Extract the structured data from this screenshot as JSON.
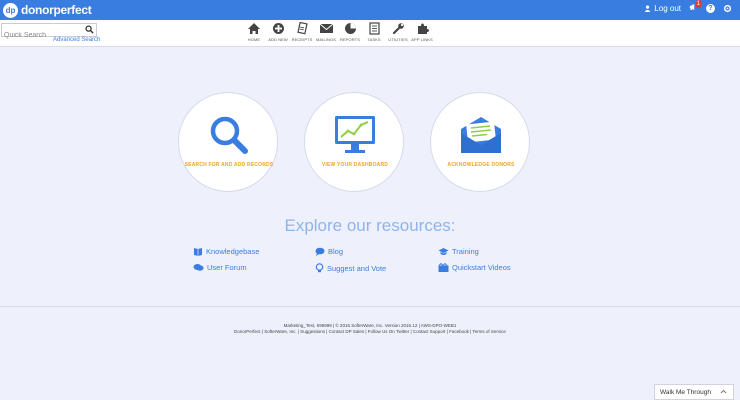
{
  "app": {
    "logo_badge": "dp",
    "logo_text": "donorperfect"
  },
  "topbar": {
    "logout_label": "Log out",
    "notification_count": "1"
  },
  "search": {
    "placeholder": "Quick Search",
    "advanced_label": "Advanced Search"
  },
  "nav": [
    {
      "label": "HOME",
      "icon": "home-icon"
    },
    {
      "label": "ADD NEW",
      "icon": "add-icon"
    },
    {
      "label": "RECEIPTS",
      "icon": "receipts-icon"
    },
    {
      "label": "MAILINGS",
      "icon": "mail-icon"
    },
    {
      "label": "REPORTS",
      "icon": "reports-icon"
    },
    {
      "label": "TASKS",
      "icon": "tasks-icon"
    },
    {
      "label": "UTILITIES",
      "icon": "wrench-icon"
    },
    {
      "label": "APP LINKS",
      "icon": "puzzle-icon"
    }
  ],
  "actions": [
    {
      "label": "SEARCH FOR AND ADD RECORDS",
      "icon": "search-icon"
    },
    {
      "label": "VIEW YOUR DASHBOARD",
      "icon": "dashboard-icon"
    },
    {
      "label": "ACKNOWLEDGE DONORS",
      "icon": "envelope-icon"
    }
  ],
  "resources": {
    "heading": "Explore our resources:",
    "items": [
      {
        "label": "Knowledgebase",
        "icon": "book-icon"
      },
      {
        "label": "Blog",
        "icon": "blog-icon"
      },
      {
        "label": "Training",
        "icon": "graduation-cap-icon"
      },
      {
        "label": "User Forum",
        "icon": "chat-icon"
      },
      {
        "label": "Suggest and Vote",
        "icon": "lightbulb-icon"
      },
      {
        "label": "Quickstart Videos",
        "icon": "video-icon"
      }
    ]
  },
  "footer": {
    "line1": "Marketing_Test, 699999 | © 2016 SofterWare, Inc. Version 2016.12 | AWS-DPO-WEB1",
    "line2": "DonorPerfect | SofterWare, Inc. | Suggestions | Contact DP Sales | Follow Us On Twitter | Contact Support | Facebook | Terms of Service"
  },
  "walkme": {
    "label": "Walk Me Through"
  },
  "colors": {
    "brand": "#3a7de0",
    "accent": "#f0a228",
    "background": "#eef1fb"
  }
}
